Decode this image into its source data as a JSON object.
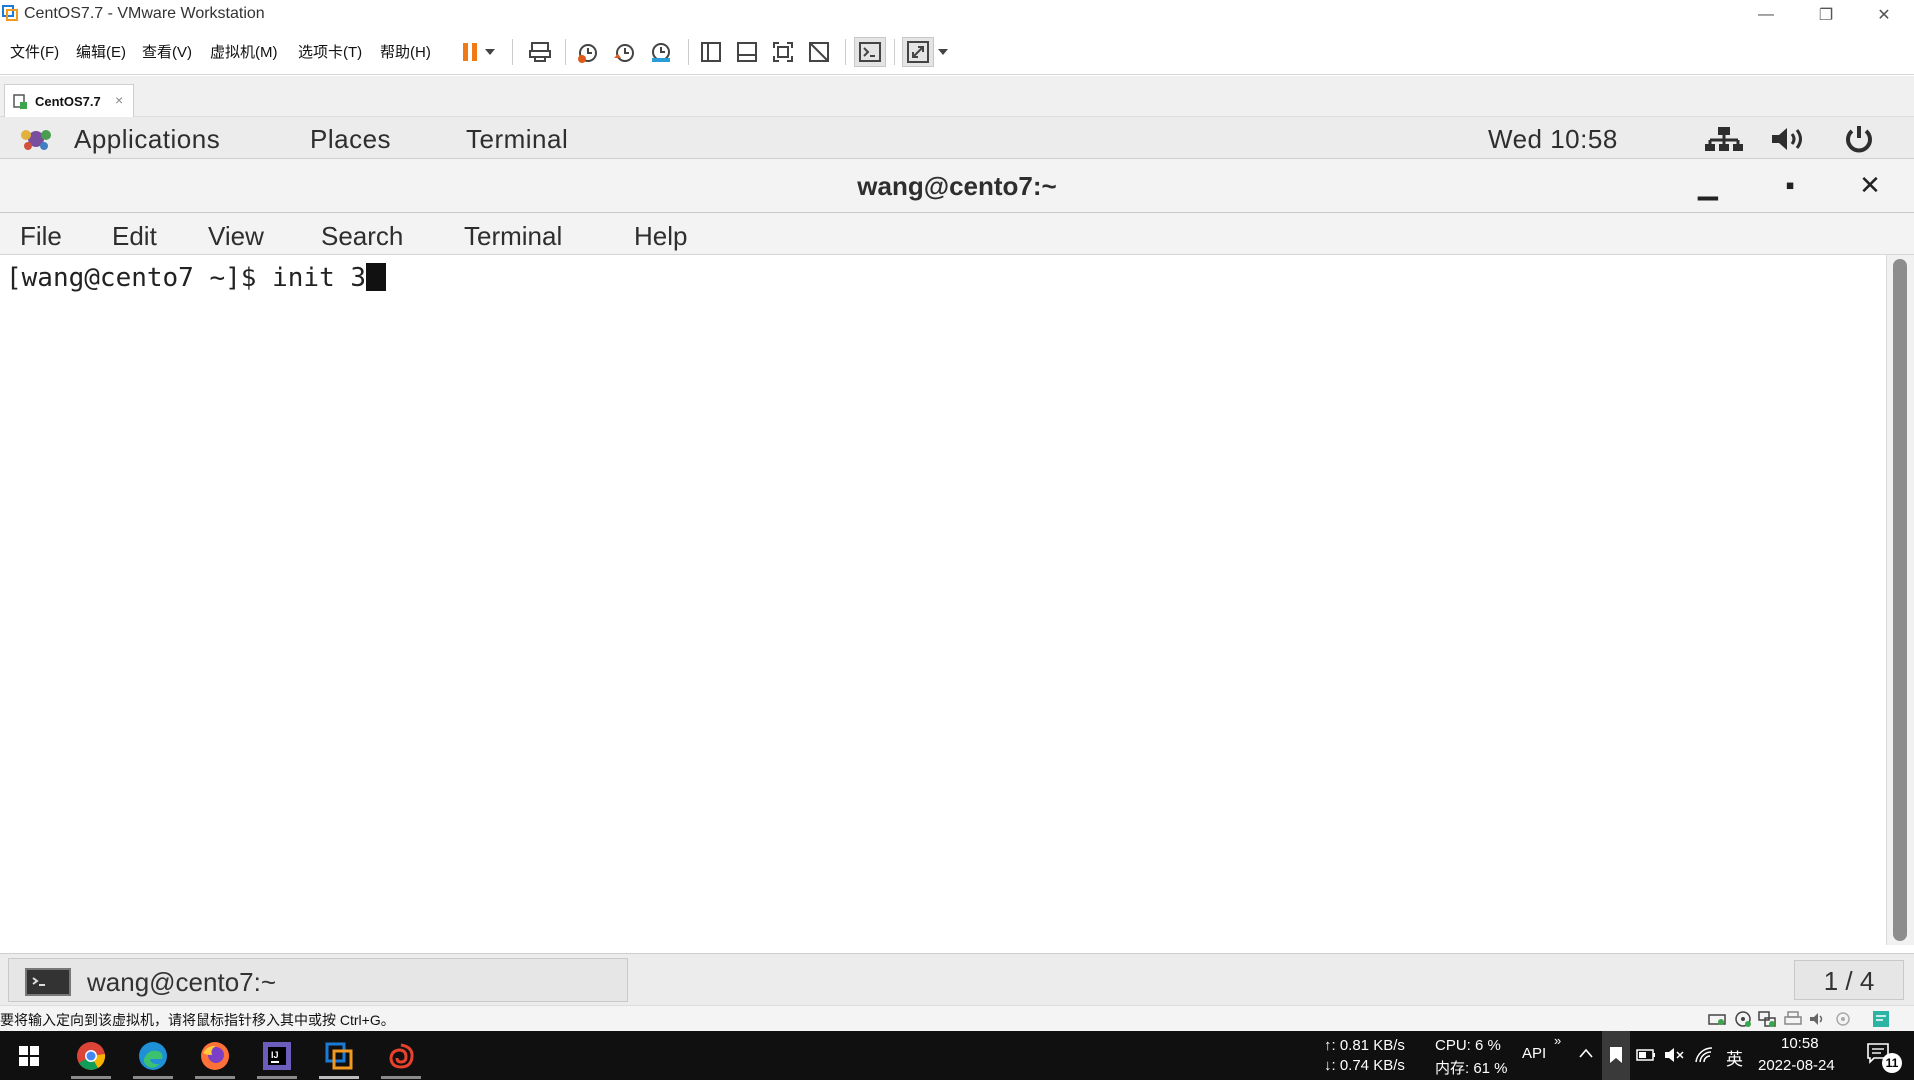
{
  "window": {
    "title": "CentOS7.7 - VMware Workstation",
    "minimize_glyph": "—",
    "restore_glyph": "❐",
    "close_glyph": "✕"
  },
  "vm_menu": [
    "文件(F)",
    "编辑(E)",
    "查看(V)",
    "虚拟机(M)",
    "选项卡(T)",
    "帮助(H)"
  ],
  "toolbar_icons": [
    "pause-icon",
    "dropdown-arrow-icon",
    "send-ctrl-alt-del-icon",
    "snapshot-icon",
    "revert-snapshot-icon",
    "snapshot-manager-icon",
    "show-library-icon",
    "thumbnail-bar-icon",
    "full-screen-icon",
    "unity-icon",
    "console-view-icon",
    "stretch-guest-icon",
    "dropdown-arrow-icon"
  ],
  "vm_tab": {
    "label": "CentOS7.7",
    "close_glyph": "×"
  },
  "gnome_top_bar": {
    "applications": "Applications",
    "places": "Places",
    "terminal": "Terminal",
    "clock": "Wed 10:58",
    "status_icons": [
      "network-icon",
      "volume-icon",
      "power-icon"
    ]
  },
  "terminal": {
    "title": "wang@cento7:~",
    "controls": {
      "minimize": "▁",
      "maximize": "▪",
      "close": "✕"
    },
    "menu": [
      "File",
      "Edit",
      "View",
      "Search",
      "Terminal",
      "Help"
    ],
    "prompt_line": "[wang@cento7 ~]$ init 3"
  },
  "gnome_bottom_bar": {
    "task_label": "wang@cento7:~",
    "workspace": "1 / 4"
  },
  "vm_status": {
    "message": "要将输入定向到该虚拟机，请将鼠标指针移入其中或按 Ctrl+G。",
    "device_icons": [
      "hard-disk-icon",
      "cd-dvd-icon",
      "network-adapter-icon",
      "printer-icon",
      "sound-card-icon",
      "display-icon",
      "message-log-icon"
    ]
  },
  "taskbar": {
    "apps": [
      "windows-start-icon",
      "chrome-icon",
      "edge-icon",
      "firefox-icon",
      "intellij-icon",
      "vmware-icon",
      "other-app-icon"
    ],
    "net_up": "↑: 0.81 KB/s",
    "net_down": "↓: 0.74 KB/s",
    "cpu": "CPU: 6 %",
    "mem": "内存: 61 %",
    "api": "API",
    "chevron": "»",
    "ime": "英",
    "time": "10:58",
    "date": "2022-08-24",
    "notifications": "11",
    "accent": "#ff5a00"
  }
}
